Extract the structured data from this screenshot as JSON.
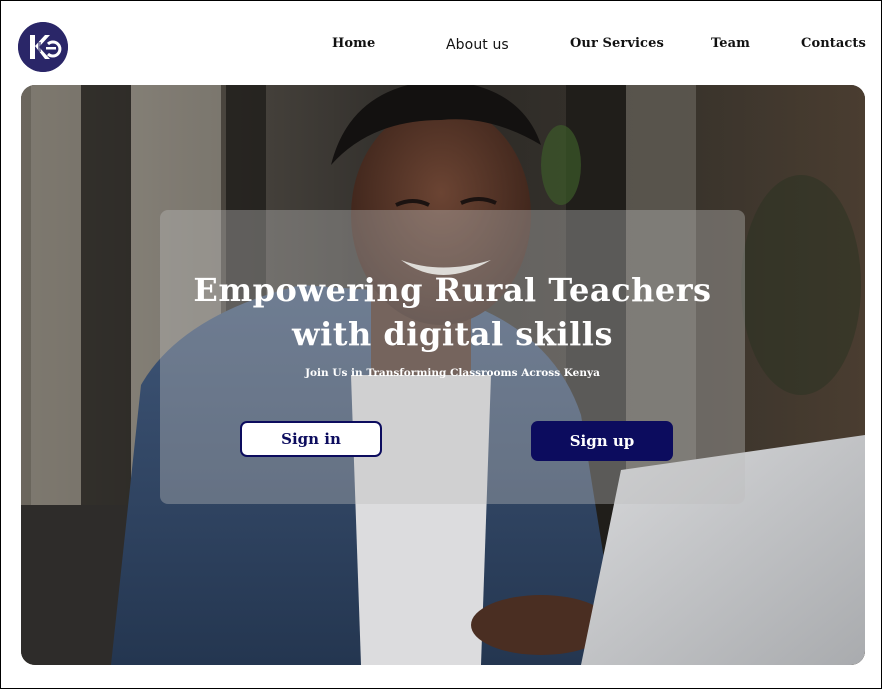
{
  "brand": {
    "logo_icon": "ke-monogram-logo",
    "logo_color": "#2a2668"
  },
  "nav": {
    "items": [
      {
        "label": "Home"
      },
      {
        "label": "About us"
      },
      {
        "label": "Our Services"
      },
      {
        "label": "Team"
      },
      {
        "label": "Contacts"
      }
    ]
  },
  "hero": {
    "image": "smiling-man-at-laptop-photo",
    "title_line1": "Empowering Rural Teachers",
    "title_line2": "with digital skills",
    "subtitle": "Join Us in Transforming Classrooms Across Kenya",
    "signin_label": "Sign in",
    "signup_label": "Sign up",
    "accent_color": "#0c0c5e"
  }
}
